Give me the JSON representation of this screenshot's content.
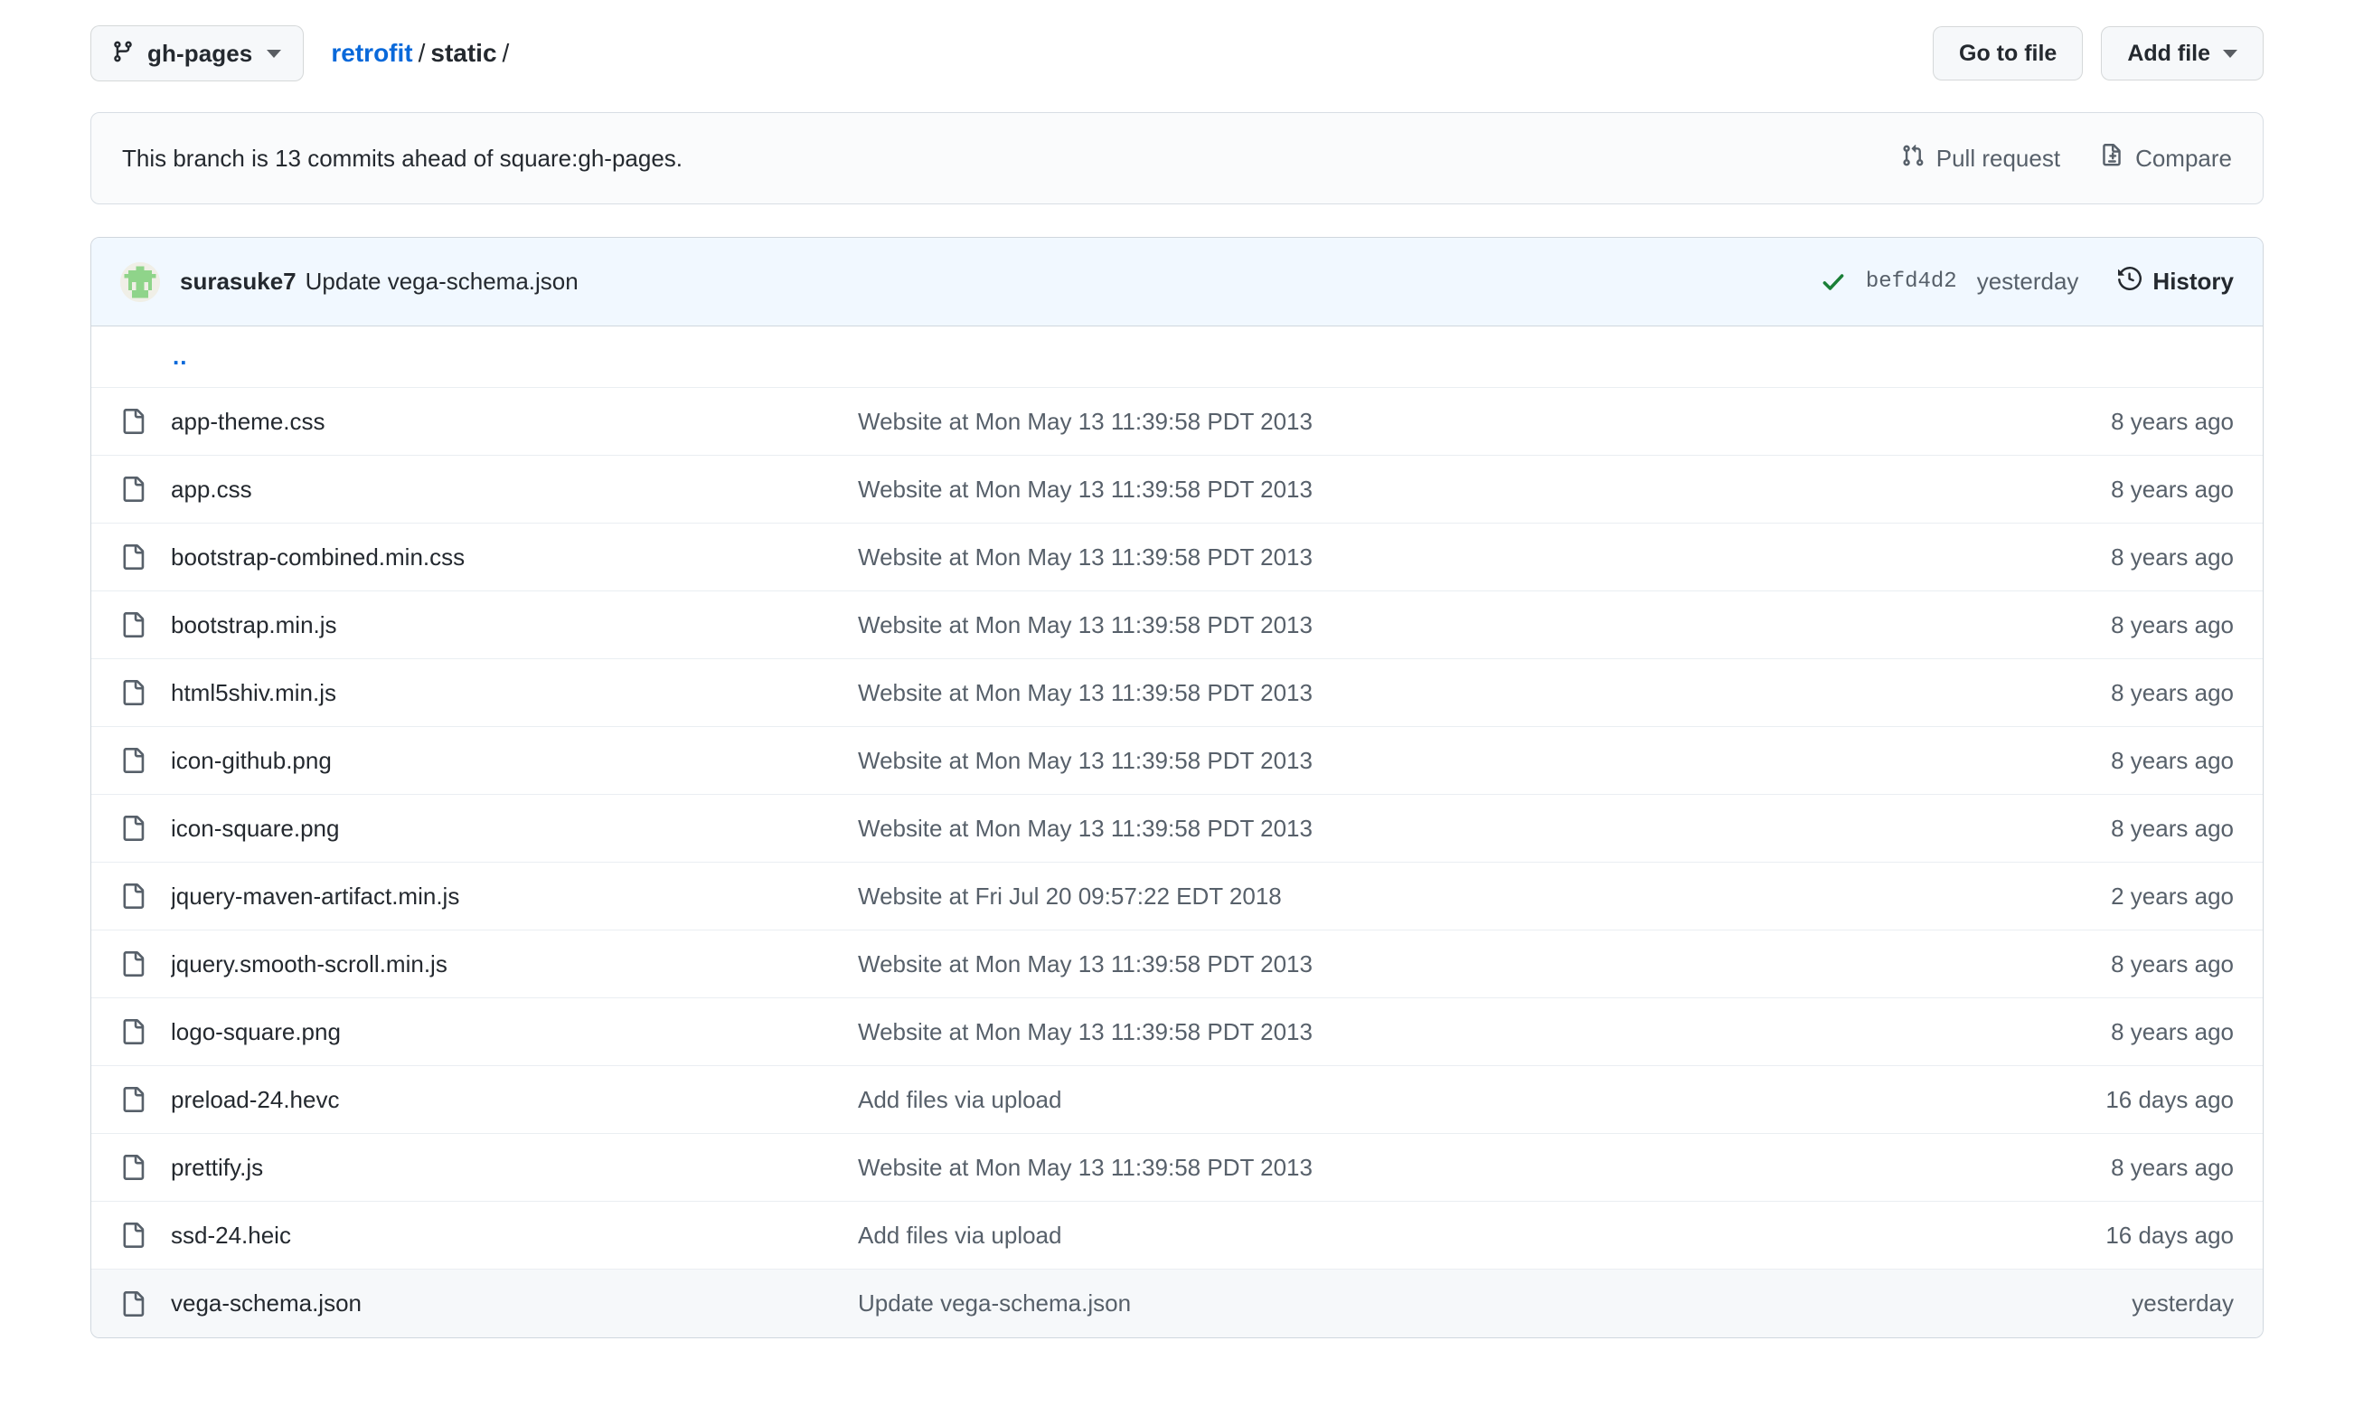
{
  "topbar": {
    "branch": "gh-pages",
    "branch_icon": "git-branch-icon",
    "breadcrumb": {
      "repo": "retrofit",
      "separator": "/",
      "current": "static",
      "trailing": "/"
    },
    "go_to_file_label": "Go to file",
    "add_file_label": "Add file"
  },
  "status_banner": {
    "text": "This branch is 13 commits ahead of square:gh-pages.",
    "pull_request_label": "Pull request",
    "compare_label": "Compare"
  },
  "commit_bar": {
    "author": "surasuke7",
    "message": "Update vega-schema.json",
    "hash": "befd4d2",
    "when": "yesterday",
    "history_label": "History"
  },
  "updir": {
    "label": ".."
  },
  "table": {
    "rows": [
      {
        "name": "app-theme.css",
        "message": "Website at Mon May 13 11:39:58 PDT 2013",
        "age": "8 years ago",
        "highlight": false
      },
      {
        "name": "app.css",
        "message": "Website at Mon May 13 11:39:58 PDT 2013",
        "age": "8 years ago",
        "highlight": false
      },
      {
        "name": "bootstrap-combined.min.css",
        "message": "Website at Mon May 13 11:39:58 PDT 2013",
        "age": "8 years ago",
        "highlight": false
      },
      {
        "name": "bootstrap.min.js",
        "message": "Website at Mon May 13 11:39:58 PDT 2013",
        "age": "8 years ago",
        "highlight": false
      },
      {
        "name": "html5shiv.min.js",
        "message": "Website at Mon May 13 11:39:58 PDT 2013",
        "age": "8 years ago",
        "highlight": false
      },
      {
        "name": "icon-github.png",
        "message": "Website at Mon May 13 11:39:58 PDT 2013",
        "age": "8 years ago",
        "highlight": false
      },
      {
        "name": "icon-square.png",
        "message": "Website at Mon May 13 11:39:58 PDT 2013",
        "age": "8 years ago",
        "highlight": false
      },
      {
        "name": "jquery-maven-artifact.min.js",
        "message": "Website at Fri Jul 20 09:57:22 EDT 2018",
        "age": "2 years ago",
        "highlight": false
      },
      {
        "name": "jquery.smooth-scroll.min.js",
        "message": "Website at Mon May 13 11:39:58 PDT 2013",
        "age": "8 years ago",
        "highlight": false
      },
      {
        "name": "logo-square.png",
        "message": "Website at Mon May 13 11:39:58 PDT 2013",
        "age": "8 years ago",
        "highlight": false
      },
      {
        "name": "preload-24.hevc",
        "message": "Add files via upload",
        "age": "16 days ago",
        "highlight": false
      },
      {
        "name": "prettify.js",
        "message": "Website at Mon May 13 11:39:58 PDT 2013",
        "age": "8 years ago",
        "highlight": false
      },
      {
        "name": "ssd-24.heic",
        "message": "Add files via upload",
        "age": "16 days ago",
        "highlight": false
      },
      {
        "name": "vega-schema.json",
        "message": "Update vega-schema.json",
        "age": "yesterday",
        "highlight": true
      }
    ]
  },
  "colors": {
    "link": "#0969da",
    "text": "#24292f",
    "muted": "#57606a",
    "border": "#d0d7de",
    "commit_bar_bg": "#f1f8ff",
    "check_green": "#1a7f37",
    "avatar_green": "#8fd48a"
  }
}
